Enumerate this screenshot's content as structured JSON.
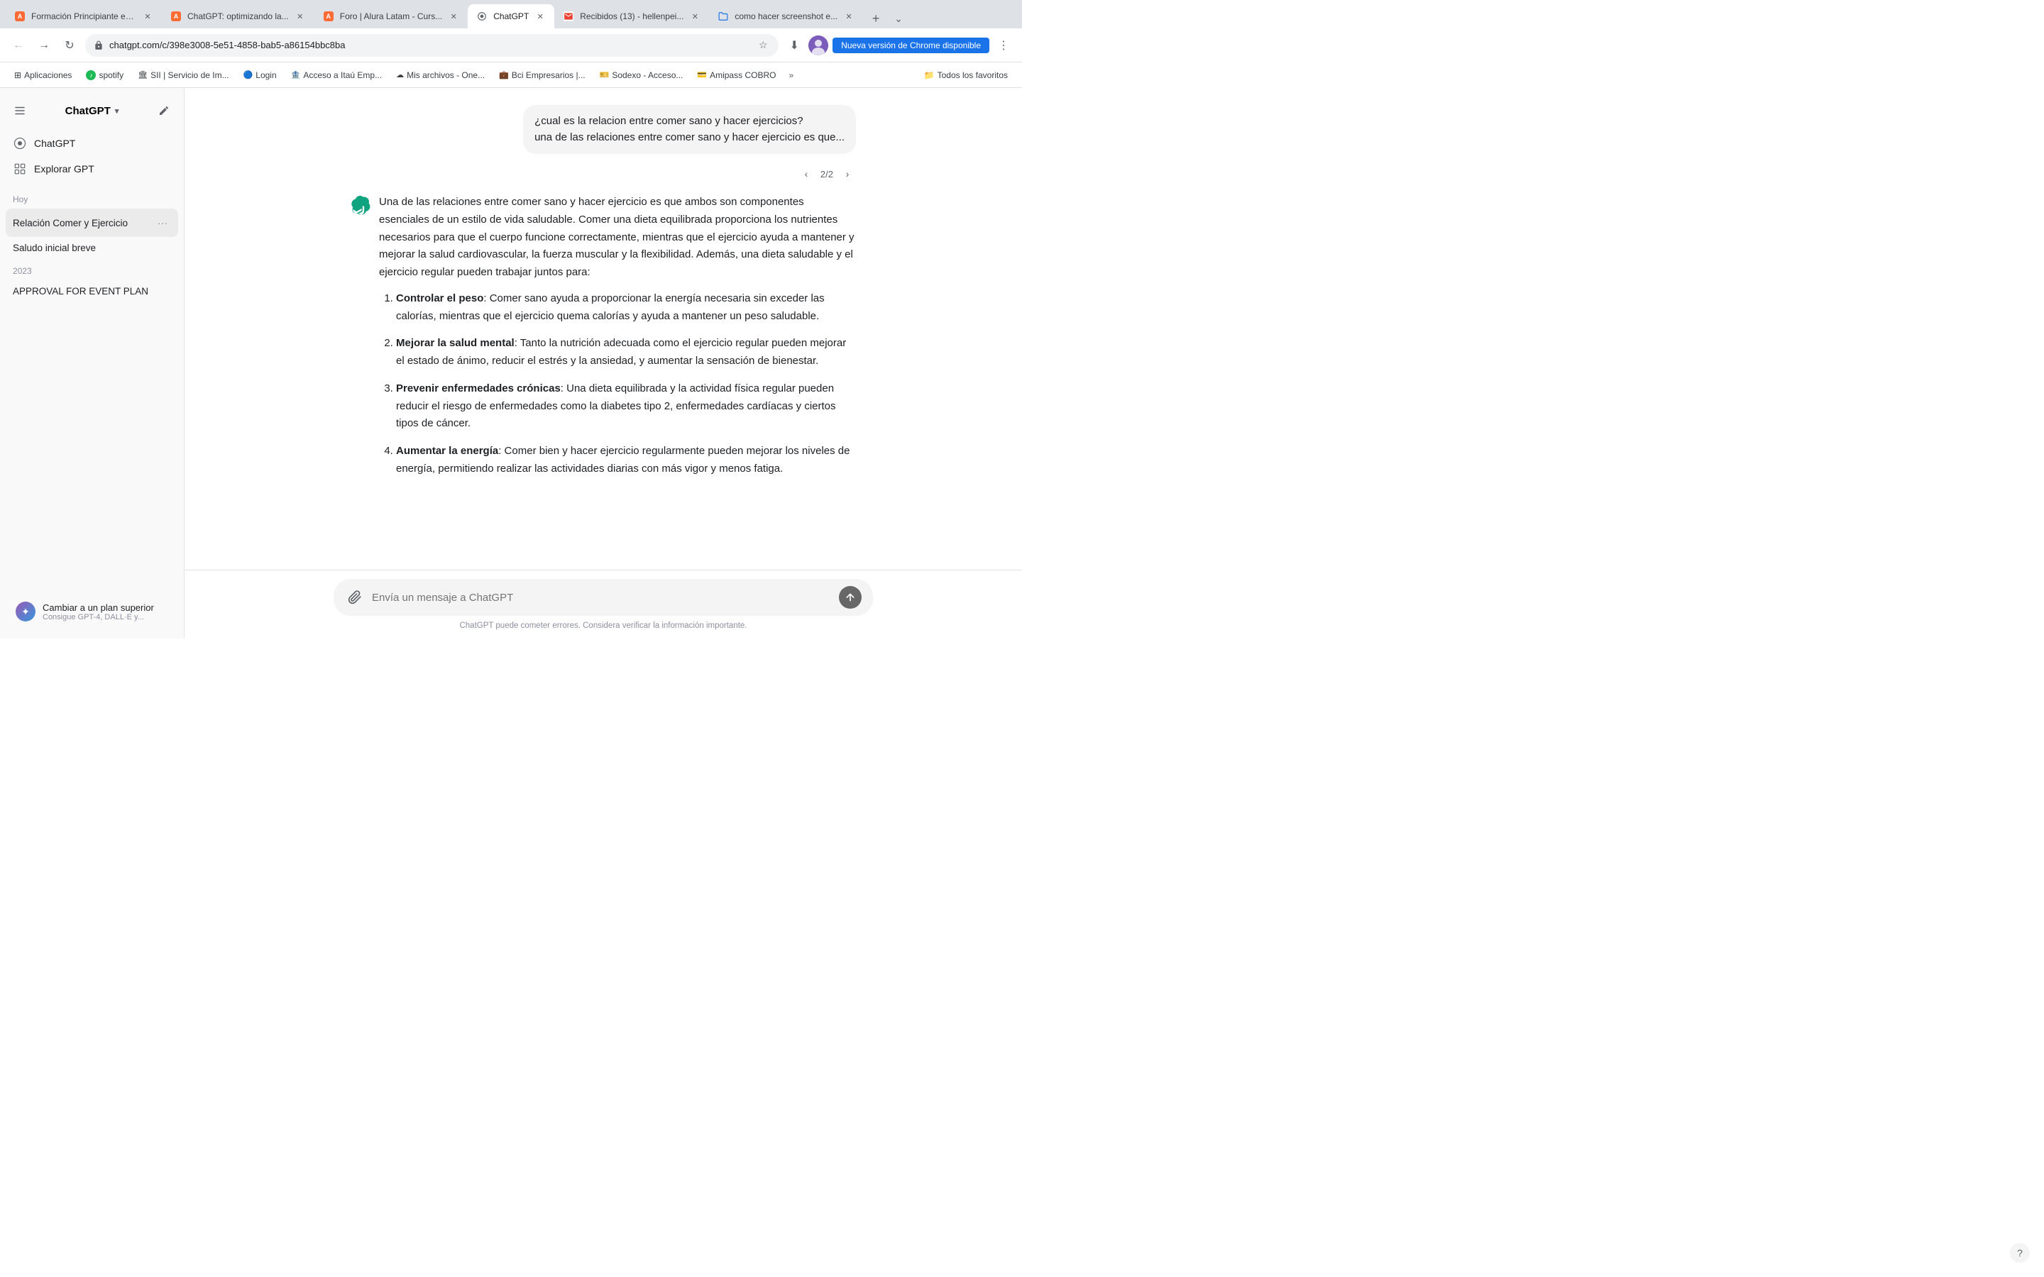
{
  "browser": {
    "tabs": [
      {
        "id": "tab1",
        "favicon": "A",
        "favicon_color": "orange",
        "title": "Formación Principiante en...",
        "active": false
      },
      {
        "id": "tab2",
        "favicon": "A",
        "favicon_color": "orange",
        "title": "ChatGPT: optimizando la...",
        "active": false
      },
      {
        "id": "tab3",
        "favicon": "A",
        "favicon_color": "orange",
        "title": "Foro | Alura Latam - Curs...",
        "active": false
      },
      {
        "id": "tab4",
        "favicon": "C",
        "favicon_color": "grey",
        "title": "ChatGPT",
        "active": true
      },
      {
        "id": "tab5",
        "favicon": "G",
        "favicon_color": "red",
        "title": "Recibidos (13) - hellenpei...",
        "active": false
      },
      {
        "id": "tab6",
        "favicon": "G",
        "favicon_color": "blue",
        "title": "como hacer screenshot e...",
        "active": false
      }
    ],
    "address": "chatgpt.com/c/398e3008-5e51-4858-bab5-a86154bbc8ba",
    "update_label": "Nueva versión de Chrome disponible"
  },
  "bookmarks": [
    {
      "label": "Aplicaciones",
      "icon": "⊞"
    },
    {
      "label": "spotify",
      "icon": "♪"
    },
    {
      "label": "SII | Servicio de Im...",
      "icon": "S"
    },
    {
      "label": "Login",
      "icon": "B"
    },
    {
      "label": "Acceso a Itaú Emp...",
      "icon": "I"
    },
    {
      "label": "Mis archivos - One...",
      "icon": "☁"
    },
    {
      "label": "Bci Empresarios |...",
      "icon": "B"
    },
    {
      "label": "Sodexo - Acceso...",
      "icon": "S"
    },
    {
      "label": "Amipass COBRO",
      "icon": "A"
    }
  ],
  "bookmarks_folder": "Todos los favoritos",
  "sidebar": {
    "logo_label": "ChatGPT",
    "logo_version": "▾",
    "nav_items": [
      {
        "id": "chatgpt",
        "icon": "◎",
        "label": "ChatGPT"
      },
      {
        "id": "explore",
        "icon": "⊞",
        "label": "Explorar GPT"
      }
    ],
    "section_today": "Hoy",
    "chats_today": [
      {
        "id": "chat1",
        "label": "Relación Comer y Ejercicio",
        "active": true
      },
      {
        "id": "chat2",
        "label": "Saludo inicial breve",
        "active": false
      }
    ],
    "section_2023": "2023",
    "chats_2023": [
      {
        "id": "chat3",
        "label": "APPROVAL FOR EVENT PLAN",
        "active": false
      }
    ],
    "upgrade_title": "Cambiar a un plan superior",
    "upgrade_sub": "Consigue GPT-4, DALL·E y..."
  },
  "chat": {
    "user_message_line1": "¿cual es la relacion entre comer sano y hacer ejercicios?",
    "user_message_line2": "una de las relaciones entre comer sano y hacer ejercicio es que...",
    "pagination_current": "2",
    "pagination_total": "2",
    "response_paragraphs": [
      "Una de las relaciones entre comer sano y hacer ejercicio es que ambos son componentes esenciales de un estilo de vida saludable. Comer una dieta equilibrada proporciona los nutrientes necesarios para que el cuerpo funcione correctamente, mientras que el ejercicio ayuda a mantener y mejorar la salud cardiovascular, la fuerza muscular y la flexibilidad. Además, una dieta saludable y el ejercicio regular pueden trabajar juntos para:"
    ],
    "list_items": [
      {
        "bold": "Controlar el peso",
        "text": ": Comer sano ayuda a proporcionar la energía necesaria sin exceder las calorías, mientras que el ejercicio quema calorías y ayuda a mantener un peso saludable."
      },
      {
        "bold": "Mejorar la salud mental",
        "text": ": Tanto la nutrición adecuada como el ejercicio regular pueden mejorar el estado de ánimo, reducir el estrés y la ansiedad, y aumentar la sensación de bienestar."
      },
      {
        "bold": "Prevenir enfermedades crónicas",
        "text": ": Una dieta equilibrada y la actividad física regular pueden reducir el riesgo de enfermedades como la diabetes tipo 2, enfermedades cardíacas y ciertos tipos de cáncer."
      },
      {
        "bold": "Aumentar la energía",
        "text": ": Comer bien y hacer ejercicio regularmente pueden mejorar los niveles de energía, permitiendo realizar las actividades diarias con más vigor y menos fatiga."
      }
    ],
    "input_placeholder": "Envía un mensaje a ChatGPT",
    "disclaimer": "ChatGPT puede cometer errores. Considera verificar la información importante."
  }
}
